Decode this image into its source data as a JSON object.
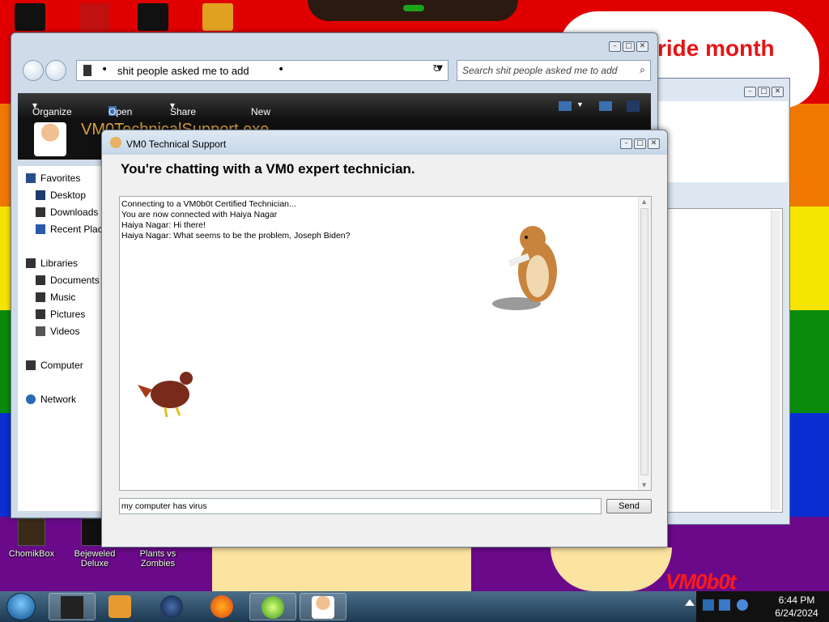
{
  "desktop": {
    "banner_text": "ride month",
    "logo_text": "VM0b0t",
    "icons": [
      {
        "label": "ChomikBox"
      },
      {
        "label": "Bejeweled Deluxe"
      },
      {
        "label": "Plants vs Zombies"
      }
    ]
  },
  "explorer": {
    "address": "shit people asked me to add",
    "search_placeholder": "Search shit people asked me to add",
    "toolbar": {
      "organize": "Organize",
      "open": "Open",
      "share_with": "Share with",
      "new_folder": "New folder"
    },
    "header_title": "VM0TechnicalSupport.exe",
    "sidebar": {
      "favorites": "Favorites",
      "desktop": "Desktop",
      "downloads": "Downloads",
      "recent_places": "Recent Places",
      "libraries": "Libraries",
      "documents": "Documents",
      "music": "Music",
      "pictures": "Pictures",
      "videos": "Videos",
      "computer": "Computer",
      "network": "Network"
    }
  },
  "chat": {
    "window_title": "VM0 Technical Support",
    "heading": "You're chatting with a VM0 expert technician.",
    "log_lines": [
      "Connecting to a VM0b0t Certified Technician...",
      "You are now connected with Haiya Nagar",
      "Haiya Nagar: Hi there!",
      "Haiya Nagar: What seems to be the problem, Joseph Biden?"
    ],
    "input_value": "my computer has virus",
    "send_label": "Send"
  },
  "taskbar": {
    "time": "6:44 PM",
    "date": "6/24/2024"
  },
  "colors": {
    "pride_red": "#e10000",
    "pride_orange": "#f07800",
    "pride_yellow": "#f5e400",
    "pride_green": "#0a8a0a",
    "pride_blue": "#0a2fd0",
    "pride_purple": "#6a0a8a"
  }
}
